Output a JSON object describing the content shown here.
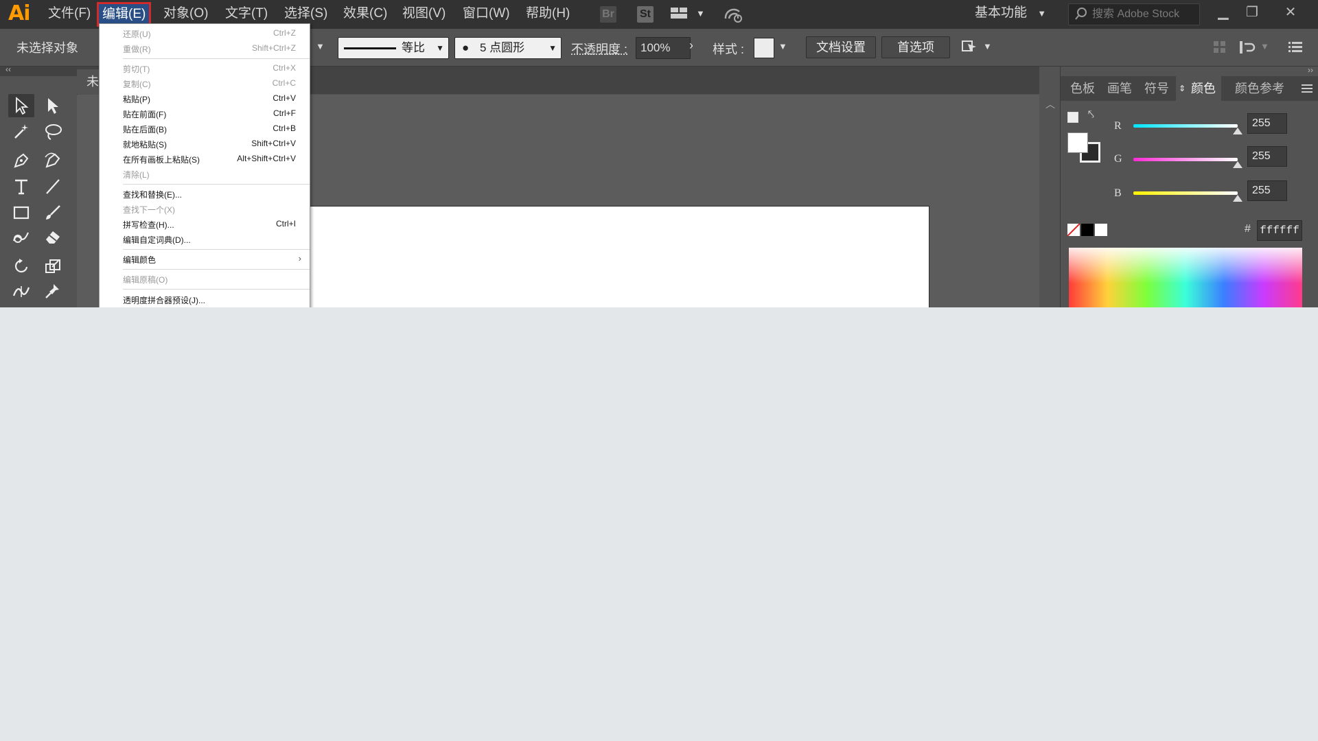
{
  "app": {
    "logo": "Ai",
    "menus": [
      "文件(F)",
      "编辑(E)",
      "对象(O)",
      "文字(T)",
      "选择(S)",
      "效果(C)",
      "视图(V)",
      "窗口(W)",
      "帮助(H)"
    ],
    "bridge_label": "Br",
    "stock_label": "St",
    "workspace": "基本功能",
    "search_placeholder": "搜索 Adobe Stock"
  },
  "control_bar": {
    "selection_status": "未选择对象",
    "stroke_profile": "等比",
    "brush": "5 点圆形",
    "opacity_label": "不透明度 :",
    "opacity_value": "100%",
    "style_label": "样式 :",
    "doc_setup_button": "文档设置",
    "preferences_button": "首选项"
  },
  "document": {
    "tab_label": "未"
  },
  "edit_menu": {
    "items": [
      {
        "label": "还原(U)",
        "shortcut": "Ctrl+Z",
        "disabled": true
      },
      {
        "label": "重做(R)",
        "shortcut": "Shift+Ctrl+Z",
        "disabled": true
      },
      {
        "label": "剪切(T)",
        "shortcut": "Ctrl+X",
        "disabled": true
      },
      {
        "label": "复制(C)",
        "shortcut": "Ctrl+C",
        "disabled": true
      },
      {
        "label": "粘贴(P)",
        "shortcut": "Ctrl+V",
        "disabled": false
      },
      {
        "label": "贴在前面(F)",
        "shortcut": "Ctrl+F",
        "disabled": false
      },
      {
        "label": "贴在后面(B)",
        "shortcut": "Ctrl+B",
        "disabled": false
      },
      {
        "label": "就地粘贴(S)",
        "shortcut": "Shift+Ctrl+V",
        "disabled": false
      },
      {
        "label": "在所有画板上粘贴(S)",
        "shortcut": "Alt+Shift+Ctrl+V",
        "disabled": false
      },
      {
        "label": "清除(L)",
        "shortcut": "",
        "disabled": true
      },
      {
        "label": "查找和替换(E)...",
        "shortcut": "",
        "disabled": false
      },
      {
        "label": "查找下一个(X)",
        "shortcut": "",
        "disabled": true
      },
      {
        "label": "拼写检查(H)...",
        "shortcut": "Ctrl+I",
        "disabled": false
      },
      {
        "label": "编辑自定词典(D)...",
        "shortcut": "",
        "disabled": false
      },
      {
        "label": "编辑颜色",
        "shortcut": "",
        "disabled": false,
        "submenu": true
      },
      {
        "label": "编辑原稿(O)",
        "shortcut": "",
        "disabled": true
      },
      {
        "label": "透明度拼合器预设(J)...",
        "shortcut": "",
        "disabled": false
      }
    ]
  },
  "color_panel": {
    "tabs": [
      "色板",
      "画笔",
      "符号",
      "颜色",
      "颜色参考"
    ],
    "active_tab": "颜色",
    "channels": [
      {
        "label": "R",
        "value": "255",
        "color": "#00e5ff"
      },
      {
        "label": "G",
        "value": "255",
        "color": "#ff2bd6"
      },
      {
        "label": "B",
        "value": "255",
        "color": "#fff200"
      }
    ],
    "hex_prefix": "#",
    "hex": "ffffff"
  },
  "colors": {
    "menu_highlight_outline": "#d22b2b",
    "logo": "#ff9a00"
  }
}
